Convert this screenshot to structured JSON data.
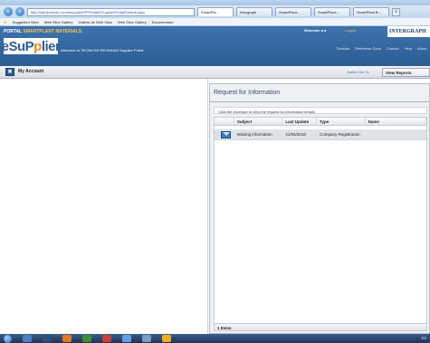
{
  "browser": {
    "url": "http://cat.tecnicas.com/esupplier/SPPortal/ESupplierPortal/Default.aspx",
    "tabs": [
      "SmartPla...",
      "Intergraph",
      "SmartPlant...",
      "SmartPlant...",
      "SmartPlant B..."
    ],
    "favorites": [
      "Suggested Sites",
      "Web Slice Gallery",
      "Galeria de Web Slice",
      "Web Slice Gallery",
      "Documentum"
    ]
  },
  "header": {
    "portal_label_1": "PORTAL",
    "portal_label_2": "SMARTPLANT MATERIALS",
    "logo_prefix": "eSuP",
    "logo_mid": "p",
    "logo_suffix": "lier",
    "welcome_portal": "Welcome to TECNICAS REUNIDAS Supplier Portal",
    "welcome_user": "Welcome a a",
    "logout": "Logout",
    "brand": "INTERGRAPH",
    "links": [
      "Tutorials",
      "Reference Docs",
      "Contact",
      "Help",
      "About"
    ]
  },
  "toolbar": {
    "my_account": "My Account",
    "switch_to": "Switch Out To",
    "view_reports": "View Reports"
  },
  "main": {
    "title": "Request for Information",
    "instruction": "Click the envelope to view the request for information details",
    "columns": [
      "",
      "Subject",
      "Last Update",
      "Type",
      "Name"
    ],
    "rows": [
      {
        "subject": "Missing information",
        "last_update": "21/06/2016",
        "type": "Company Registration",
        "name": ""
      }
    ],
    "footer": "1 Items"
  },
  "taskbar": {
    "tray_text": "ES"
  }
}
